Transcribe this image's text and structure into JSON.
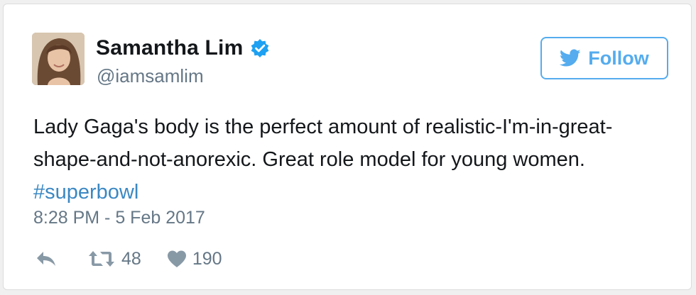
{
  "tweet": {
    "author": {
      "display_name": "Samantha Lim",
      "handle": "@iamsamlim",
      "verified": true
    },
    "follow_button": {
      "label": "Follow",
      "icon": "twitter-bird-icon"
    },
    "text_lines": [
      "Lady Gaga's body is the perfect amount of realistic-I'm-in-great-",
      "shape-and-not-anorexic. Great role model for young women."
    ],
    "hashtag": "#superbowl",
    "timestamp": "8:28 PM - 5 Feb 2017",
    "actions": {
      "reply": {
        "icon": "reply-icon"
      },
      "retweet": {
        "icon": "retweet-icon",
        "count": "48"
      },
      "like": {
        "icon": "heart-icon",
        "count": "190"
      }
    }
  },
  "colors": {
    "twitter_blue": "#55acee",
    "hashtag_blue": "#3b88c3",
    "verified_blue": "#1da1f2",
    "secondary_text": "#657786",
    "primary_text": "#14171a"
  }
}
